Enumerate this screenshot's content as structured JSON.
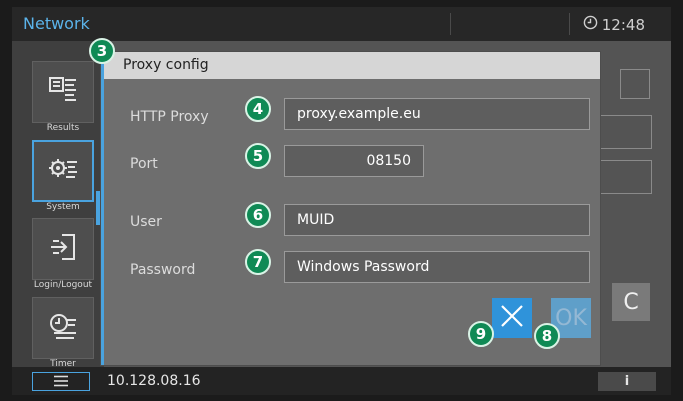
{
  "window": {
    "title": "Network",
    "time": "12:48"
  },
  "sidebar": {
    "items": [
      {
        "label": "Results",
        "icon": "results-icon"
      },
      {
        "label": "System",
        "icon": "system-gear-icon",
        "active": true
      },
      {
        "label": "Login/Logout",
        "icon": "login-logout-icon"
      },
      {
        "label": "Timer",
        "icon": "timer-icon"
      }
    ]
  },
  "statusbar": {
    "ip": "10.128.08.16",
    "info_label": "i",
    "menu_icon": "hamburger-icon"
  },
  "background": {
    "c_label": "C"
  },
  "dialog": {
    "badge": "3",
    "title": "Proxy config",
    "fields": {
      "http_proxy": {
        "label": "HTTP Proxy",
        "value": "proxy.example.eu",
        "badge": "4"
      },
      "port": {
        "label": "Port",
        "value": "08150",
        "badge": "5"
      },
      "user": {
        "label": "User",
        "value": "MUID",
        "badge": "6"
      },
      "password": {
        "label": "Password",
        "value": "Windows Password",
        "badge": "7"
      }
    },
    "ok": {
      "label": "OK",
      "badge": "8"
    },
    "cancel": {
      "icon": "close-icon",
      "badge": "9"
    }
  },
  "colors": {
    "accent": "#4aa3df",
    "badge": "#0f8a55",
    "title": "#5bb3ea"
  }
}
